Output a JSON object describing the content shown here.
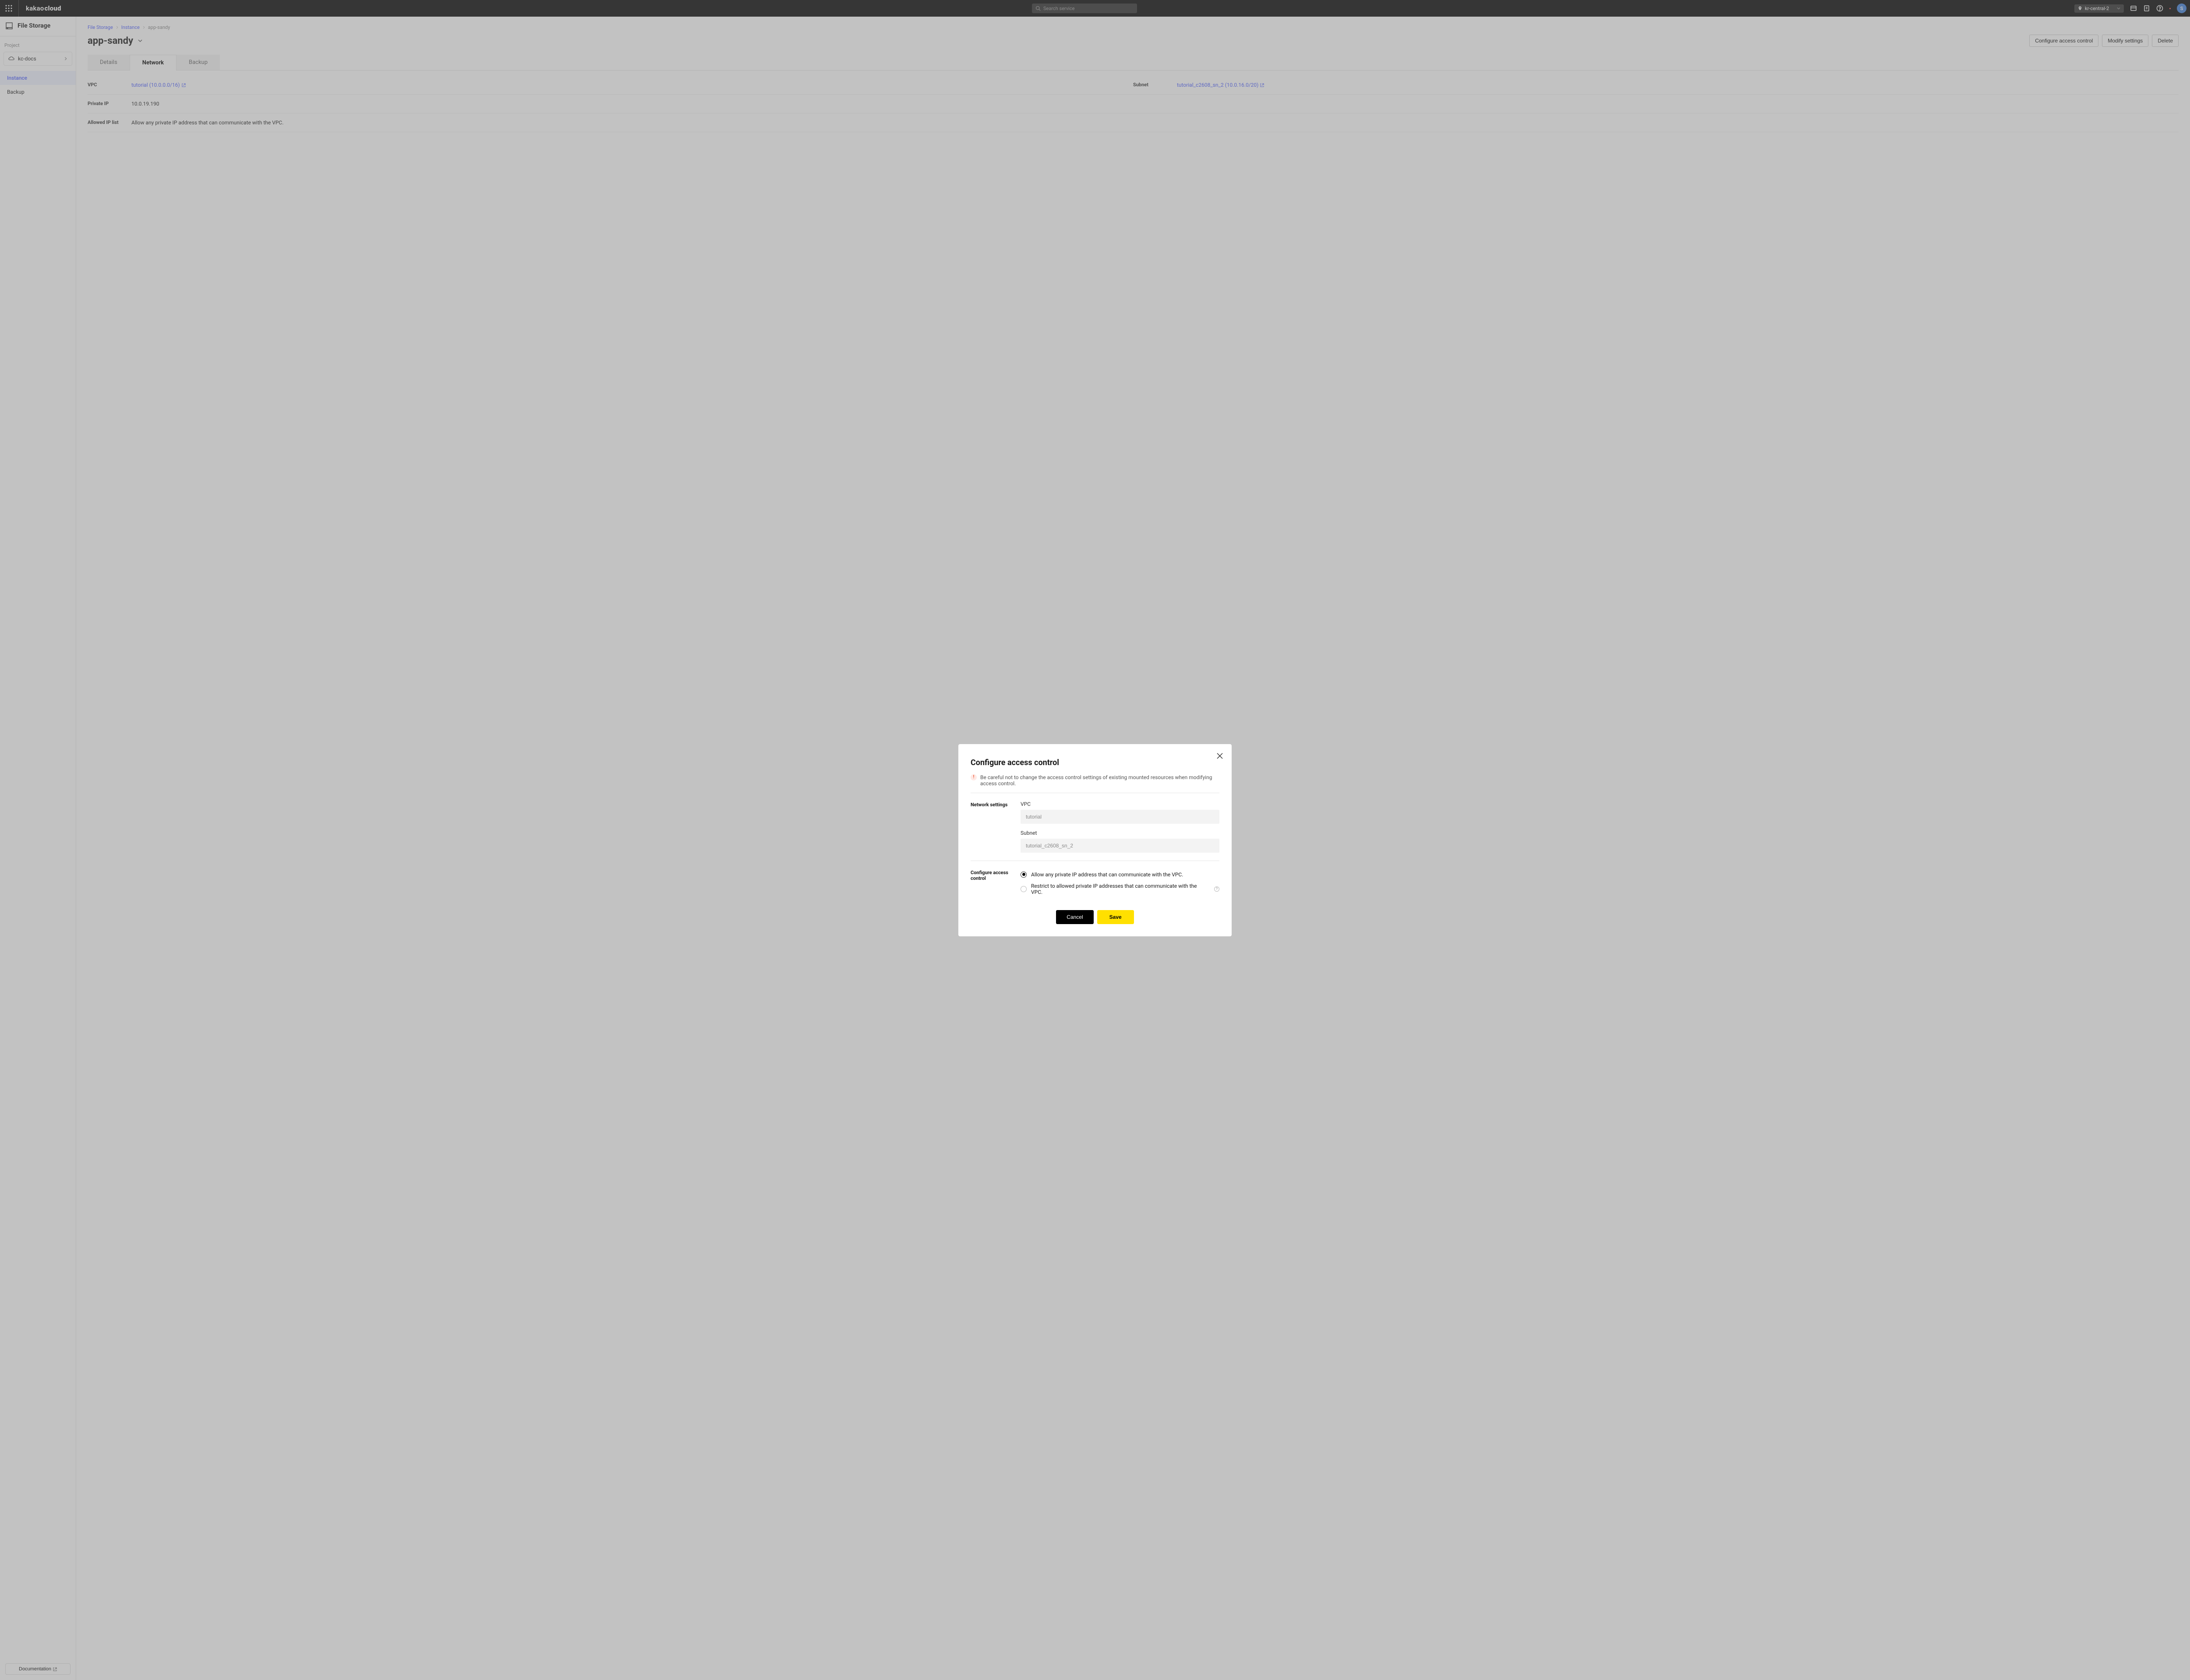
{
  "header": {
    "logo_a": "kakao",
    "logo_b": "cloud",
    "search_placeholder": "Search service",
    "region": "kr-central-2",
    "avatar_initial": "S"
  },
  "sidebar": {
    "service_name": "File Storage",
    "project_label": "Project",
    "project_name": "kc-docs",
    "nav": [
      {
        "label": "Instance",
        "active": true
      },
      {
        "label": "Backup",
        "active": false
      }
    ],
    "doc_button": "Documentation"
  },
  "breadcrumb": {
    "a": "File Storage",
    "b": "Instance",
    "c": "app-sandy"
  },
  "page": {
    "title": "app-sandy",
    "actions": {
      "configure": "Configure access control",
      "modify": "Modify settings",
      "delete": "Delete"
    }
  },
  "tabs": {
    "details": "Details",
    "network": "Network",
    "backup": "Backup"
  },
  "network_panel": {
    "vpc_label": "VPC",
    "vpc_value": "tutorial (10.0.0.0/16)",
    "subnet_label": "Subnet",
    "subnet_value": "tutorial_c2608_sn_2 (10.0.16.0/20)",
    "private_ip_label": "Private IP",
    "private_ip_value": "10.0.19.190",
    "allowed_ip_label": "Allowed IP list",
    "allowed_ip_value": "Allow any private IP address that can communicate with the VPC."
  },
  "modal": {
    "title": "Configure access control",
    "warning": "Be careful not to change the access control settings of existing mounted resources when modifying access control.",
    "network_settings_label": "Network settings",
    "vpc_field_label": "VPC",
    "vpc_field_value": "tutorial",
    "subnet_field_label": "Subnet",
    "subnet_field_value": "tutorial_c2608_sn_2",
    "access_control_label": "Configure access control",
    "radio_allow": "Allow any private IP address that can communicate with the VPC.",
    "radio_restrict": "Restrict to allowed private IP addresses that can communicate with the VPC.",
    "cancel": "Cancel",
    "save": "Save"
  }
}
